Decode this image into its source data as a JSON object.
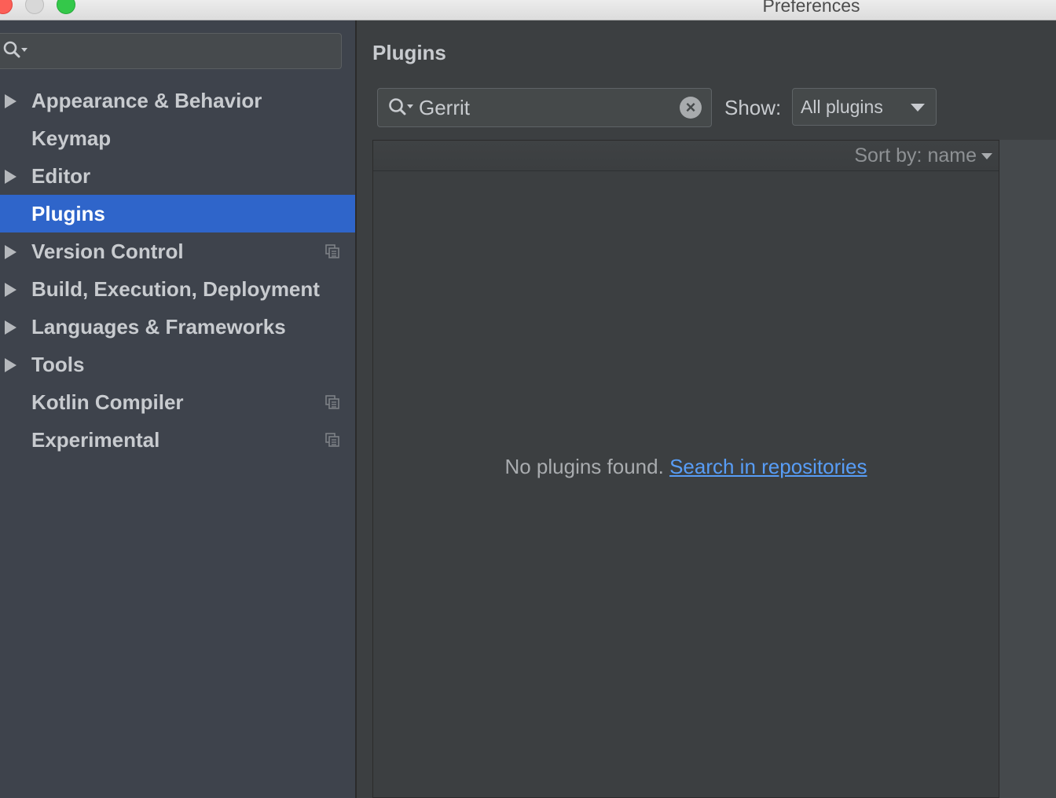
{
  "window": {
    "title": "Preferences"
  },
  "sidebar": {
    "search": {
      "value": ""
    },
    "items": [
      {
        "label": "Appearance & Behavior",
        "expandable": true,
        "selected": false,
        "project_level": false
      },
      {
        "label": "Keymap",
        "expandable": false,
        "selected": false,
        "project_level": false
      },
      {
        "label": "Editor",
        "expandable": true,
        "selected": false,
        "project_level": false
      },
      {
        "label": "Plugins",
        "expandable": false,
        "selected": true,
        "project_level": false
      },
      {
        "label": "Version Control",
        "expandable": true,
        "selected": false,
        "project_level": true
      },
      {
        "label": "Build, Execution, Deployment",
        "expandable": true,
        "selected": false,
        "project_level": false
      },
      {
        "label": "Languages & Frameworks",
        "expandable": true,
        "selected": false,
        "project_level": false
      },
      {
        "label": "Tools",
        "expandable": true,
        "selected": false,
        "project_level": false
      },
      {
        "label": "Kotlin Compiler",
        "expandable": false,
        "selected": false,
        "project_level": true
      },
      {
        "label": "Experimental",
        "expandable": false,
        "selected": false,
        "project_level": true
      }
    ]
  },
  "main": {
    "title": "Plugins",
    "search": {
      "value": "Gerrit"
    },
    "show_label": "Show:",
    "show_value": "All plugins",
    "sort_label": "Sort by: name",
    "empty_text": "No plugins found.",
    "empty_link": "Search in repositories"
  },
  "colors": {
    "selection": "#2f65ca",
    "link": "#589df6",
    "sidebar_bg": "#3e434c",
    "panel_bg": "#3c3f41"
  },
  "icons": {
    "search": "search-icon",
    "clear": "clear-icon",
    "expand": "chevron-right-icon",
    "dropdown": "chevron-down-icon",
    "project_level": "project-settings-icon"
  }
}
